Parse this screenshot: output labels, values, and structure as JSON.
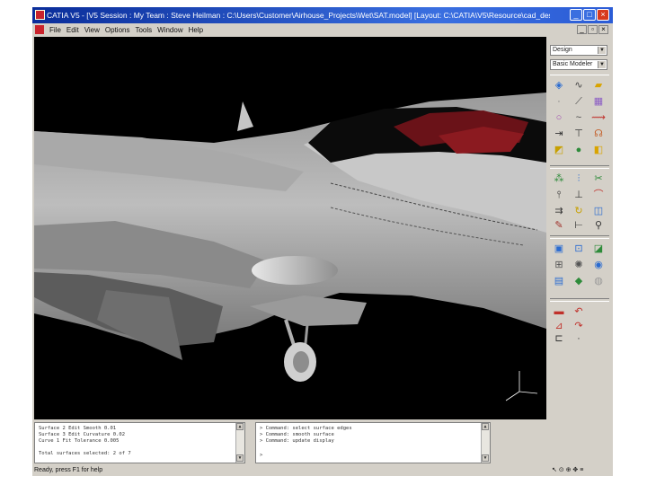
{
  "titlebar": {
    "title": "CATIA V5 - [V5 Session : My Team : Steve Heilman : C:\\Users\\Customer\\Airhouse_Projects\\Wet\\SAT.model]  [Layout: C:\\CATIA\\V5\\Resource\\cad_des.xml]",
    "min_label": "_",
    "max_label": "□",
    "close_label": "×"
  },
  "menubar": {
    "items": [
      "File",
      "Edit",
      "View",
      "Options",
      "Tools",
      "Window",
      "Help"
    ],
    "mdi_min": "_",
    "mdi_max": "▫",
    "mdi_close": "×"
  },
  "right_panel": {
    "dropdown_1": "Design",
    "dropdown_2": "Basic Modeler",
    "dropdown_arrow": "▼"
  },
  "bottom": {
    "console1_lines": [
      "Surface 2        Edit     Smooth 0.01",
      "Surface 3        Edit     Curvature 0.02",
      "Curve 1          Fit      Tolerance 0.005",
      "",
      "Total surfaces selected:   2 of 7"
    ],
    "console2_lines": [
      "> Command: select surface edges",
      "> Command: smooth surface",
      "> Command: update display",
      "",
      ">"
    ],
    "scroll_up": "▲",
    "scroll_down": "▼"
  },
  "status": {
    "left_text": "Ready, press F1 for help",
    "right_text": "↖ ⊙ ⊕ ✥ ≡"
  },
  "colors": {
    "title_bar": "#0a2d9a",
    "chrome": "#d4d0c8",
    "viewport": "#000000",
    "canopy_tint": "#6a1218"
  }
}
